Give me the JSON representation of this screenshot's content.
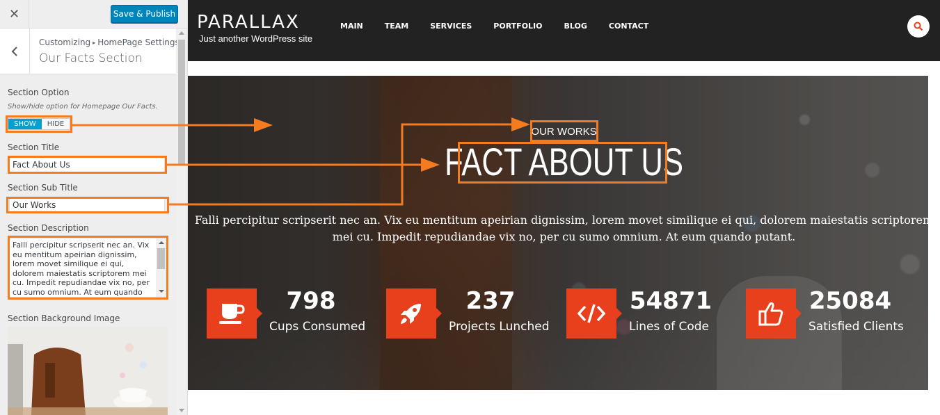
{
  "sidebar": {
    "close_label": "✕",
    "publish_label": "Save & Publish",
    "breadcrumb_root": "Customizing",
    "breadcrumb_parent": "HomePage Settings",
    "panel_title": "Our Facts Section",
    "section_option": {
      "label": "Section Option",
      "description": "Show/hide option for Homepage Our Facts.",
      "show_label": "SHOW",
      "hide_label": "HIDE",
      "selected": "SHOW"
    },
    "section_title": {
      "label": "Section Title",
      "value": "Fact About Us"
    },
    "section_sub_title": {
      "label": "Section Sub Title",
      "value": "Our Works"
    },
    "section_description": {
      "label": "Section Description",
      "value": "Falli percipitur scripserit nec an. Vix eu mentitum apeirian dignissim, lorem movet similique ei qui, dolorem maiestatis scriptorem mei cu. Impedit repudiandae vix no, per cu sumo omnium. At eum quando putant."
    },
    "section_bg_image": {
      "label": "Section Background Image"
    }
  },
  "site": {
    "logo": "PARALLAX",
    "tagline": "Just another WordPress site",
    "nav": [
      "MAIN",
      "TEAM",
      "SERVICES",
      "PORTFOLIO",
      "BLOG",
      "CONTACT"
    ],
    "facts_section": {
      "sub_title": "OUR WORKS",
      "title": "FACT ABOUT US",
      "description": "Falli percipitur scripserit nec an. Vix eu mentitum apeirian dignissim, lorem movet similique ei qui, dolorem maiestatis scriptorem mei cu. Impedit repudiandae vix no, per cu sumo omnium. At eum quando putant.",
      "facts": [
        {
          "icon": "coffee-cup-icon",
          "number": "798",
          "label": "Cups Consumed"
        },
        {
          "icon": "rocket-icon",
          "number": "237",
          "label": "Projects Lunched"
        },
        {
          "icon": "code-icon",
          "number": "54871",
          "label": "Lines of Code"
        },
        {
          "icon": "thumbs-up-icon",
          "number": "25084",
          "label": "Satisfied Clients"
        }
      ]
    }
  },
  "colors": {
    "accent": "#e8401c",
    "annotation": "#f47b20",
    "publish_blue": "#0085ba",
    "topbar": "#222222"
  }
}
